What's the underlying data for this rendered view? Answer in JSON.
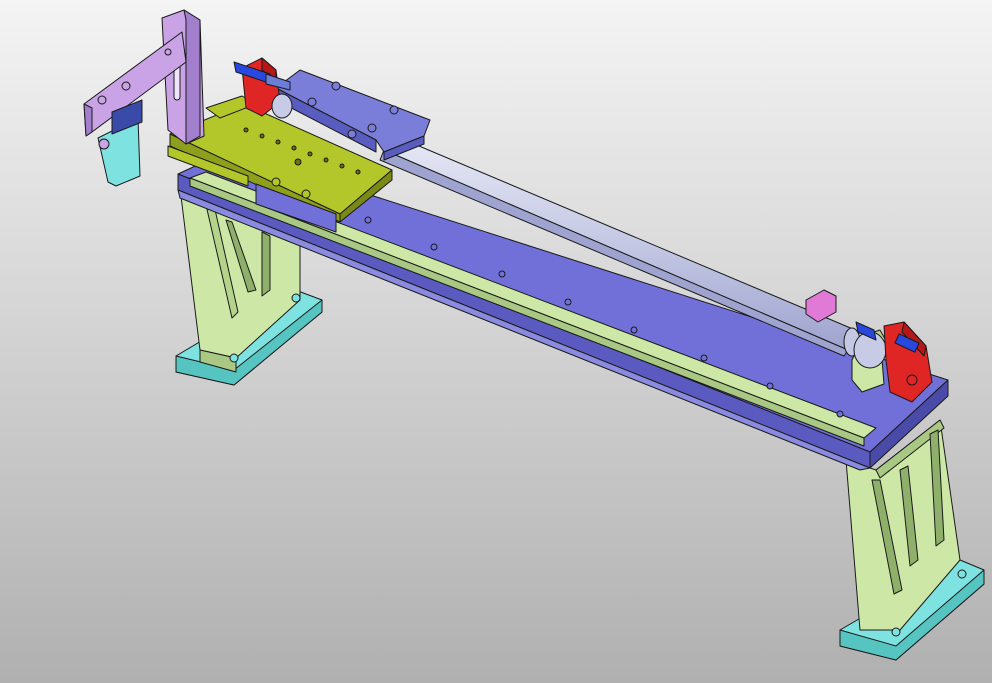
{
  "scene": {
    "description_visible_text": "",
    "colors": {
      "background_top": "#f5f5f5",
      "background_bottom": "#b0b0b0",
      "base_plate": "#7070d8",
      "base_plate_edge": "#5555b5",
      "legs": "#cde8a6",
      "leg_edge": "#5a6e3e",
      "feet": "#7ee3e0",
      "rail": "#cde8a6",
      "carriage": "#b3c72a",
      "carriage_edge": "#6a7410",
      "cylinder": "#c7cbe6",
      "cylinder_mount": "#7b7ed8",
      "end_caps": "#e02525",
      "fittings": "#2848e0",
      "arm": "#c9a3e6",
      "gripper": "#7ee3e0",
      "sensor": "#e07ad6",
      "outline": "#1a1a1a"
    }
  }
}
